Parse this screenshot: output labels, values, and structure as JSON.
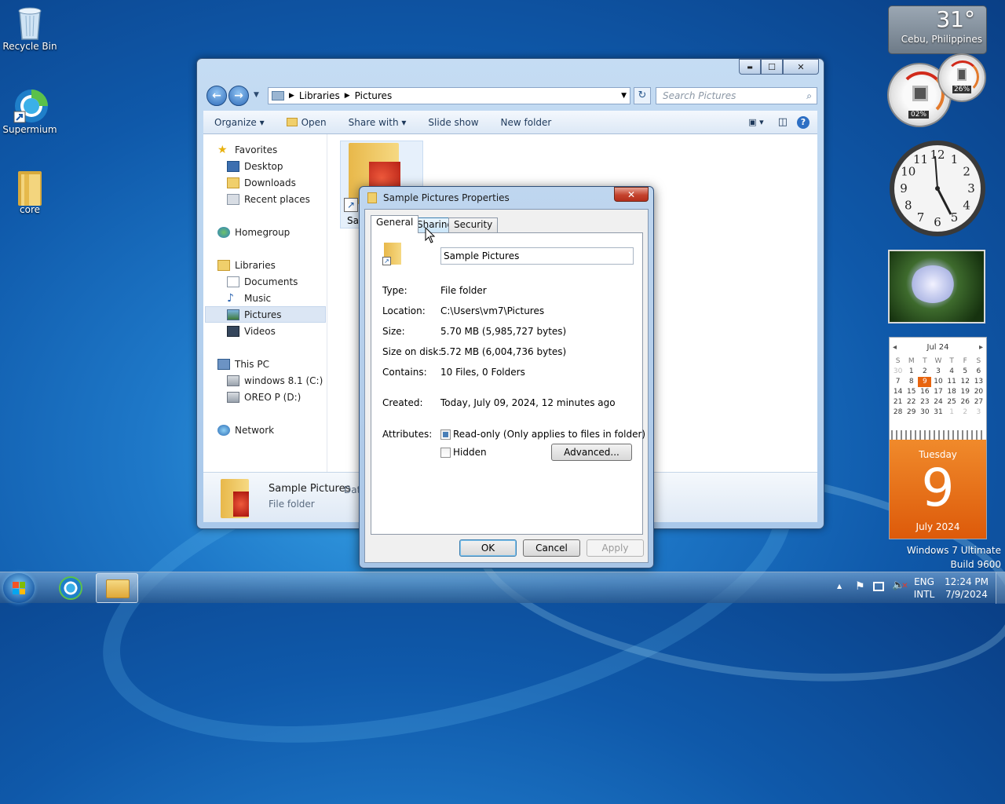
{
  "desktop": {
    "icons": [
      {
        "label": "Recycle Bin"
      },
      {
        "label": "Supermium"
      },
      {
        "label": "core"
      }
    ],
    "watermark": {
      "line1": "Windows 7 Ultimate",
      "line2": "Build 9600"
    }
  },
  "explorer": {
    "controls": {
      "minimize": "▬",
      "maximize": "☐",
      "close": "✕"
    },
    "breadcrumb": [
      "Libraries",
      "Pictures"
    ],
    "search_placeholder": "Search Pictures",
    "toolbar": {
      "organize": "Organize",
      "open": "Open",
      "share_with": "Share with",
      "slide_show": "Slide show",
      "new_folder": "New folder"
    },
    "nav": {
      "favorites": "Favorites",
      "desktop": "Desktop",
      "downloads": "Downloads",
      "recent_places": "Recent places",
      "homegroup": "Homegroup",
      "libraries": "Libraries",
      "documents": "Documents",
      "music": "Music",
      "pictures": "Pictures",
      "videos": "Videos",
      "this_pc": "This PC",
      "drive_c": "windows 8.1 (C:)",
      "drive_d": "OREO P (D:)",
      "network": "Network"
    },
    "file_item_label": "Sar",
    "details": {
      "name": "Sample Pictures",
      "date_label": "Date",
      "type": "File folder"
    }
  },
  "dialog": {
    "title": "Sample Pictures Properties",
    "close": "✕",
    "tabs": [
      "General",
      "Sharing",
      "Security"
    ],
    "folder_name": "Sample Pictures",
    "fields": [
      {
        "label": "Type:",
        "value": "File folder"
      },
      {
        "label": "Location:",
        "value": "C:\\Users\\vm7\\Pictures"
      },
      {
        "label": "Size:",
        "value": "5.70 MB (5,985,727 bytes)"
      },
      {
        "label": "Size on disk:",
        "value": "5.72 MB (6,004,736 bytes)"
      },
      {
        "label": "Contains:",
        "value": "10 Files, 0 Folders"
      }
    ],
    "created": {
      "label": "Created:",
      "value": "Today, July 09, 2024, 12 minutes ago"
    },
    "attributes": {
      "label": "Attributes:",
      "readonly": "Read-only (Only applies to files in folder)",
      "readonly_state": "indeterminate",
      "hidden": "Hidden",
      "hidden_checked": false,
      "advanced": "Advanced..."
    },
    "buttons": {
      "ok": "OK",
      "cancel": "Cancel",
      "apply": "Apply"
    }
  },
  "gadgets": {
    "weather": {
      "temp": "31°",
      "location": "Cebu, Philippines"
    },
    "meter": {
      "cpu": "02%",
      "ram": "26%"
    },
    "clock": {
      "numbers": [
        "12",
        "1",
        "2",
        "3",
        "4",
        "5",
        "6",
        "7",
        "8",
        "9",
        "10",
        "11"
      ]
    },
    "calendar": {
      "month": "Jul 24",
      "prev": "◂",
      "next": "▸",
      "weekdays": [
        "S",
        "M",
        "T",
        "W",
        "T",
        "F",
        "S"
      ],
      "weeks": [
        [
          "30",
          "1",
          "2",
          "3",
          "4",
          "5",
          "6"
        ],
        [
          "7",
          "8",
          "9",
          "10",
          "11",
          "12",
          "13"
        ],
        [
          "14",
          "15",
          "16",
          "17",
          "18",
          "19",
          "20"
        ],
        [
          "21",
          "22",
          "23",
          "24",
          "25",
          "26",
          "27"
        ],
        [
          "28",
          "29",
          "30",
          "31",
          "1",
          "2",
          "3"
        ]
      ],
      "today": "9",
      "day_name": "Tuesday",
      "day_number": "9",
      "month_year": "July 2024"
    }
  },
  "taskbar": {
    "lang": "ENG",
    "layout": "INTL",
    "time": "12:24 PM",
    "date": "7/9/2024",
    "tray_arrow": "▲"
  },
  "colors": {
    "accent_orange": "#e8640e",
    "title_blue": "#1e395b"
  }
}
